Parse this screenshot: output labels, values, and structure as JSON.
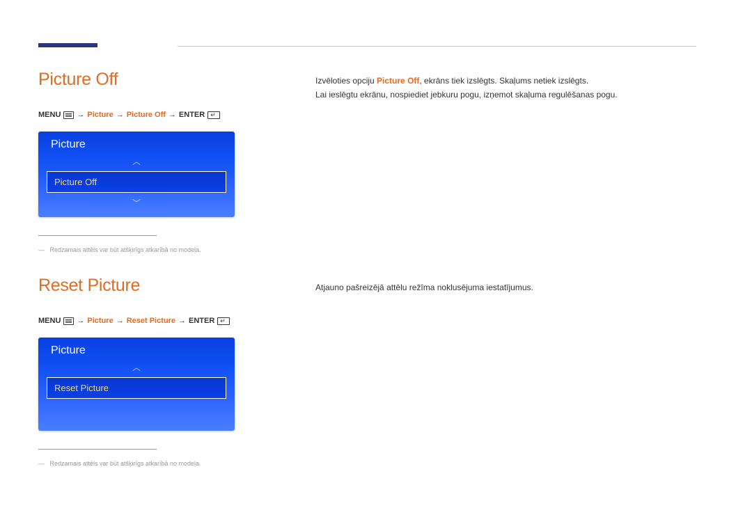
{
  "section1": {
    "title": "Picture Off",
    "breadcrumb": {
      "menu_label": "MENU",
      "item1": "Picture",
      "item2": "Picture Off",
      "enter_label": "ENTER"
    },
    "panel": {
      "header": "Picture",
      "selected": "Picture Off"
    },
    "disclaimer": "Redzamais attēls var būt atšķirīgs atkarībā no modeļa.",
    "body_prefix": "Izvēloties opciju ",
    "body_highlight": "Picture Off",
    "body_suffix": ", ekrāns tiek izslēgts. Skaļums netiek izslēgts.",
    "body_line2": "Lai ieslēgtu ekrānu, nospiediet jebkuru pogu, izņemot skaļuma regulēšanas pogu."
  },
  "section2": {
    "title": "Reset Picture",
    "breadcrumb": {
      "menu_label": "MENU",
      "item1": "Picture",
      "item2": "Reset Picture",
      "enter_label": "ENTER"
    },
    "panel": {
      "header": "Picture",
      "selected": "Reset Picture"
    },
    "disclaimer": "Redzamais attēls var būt atšķirīgs atkarībā no modeļa.",
    "body_line1": "Atjauno pašreizējā attēlu režīma noklusējuma iestatījumus."
  },
  "arrows": {
    "right": "→",
    "up": "︿",
    "down": "﹀"
  }
}
